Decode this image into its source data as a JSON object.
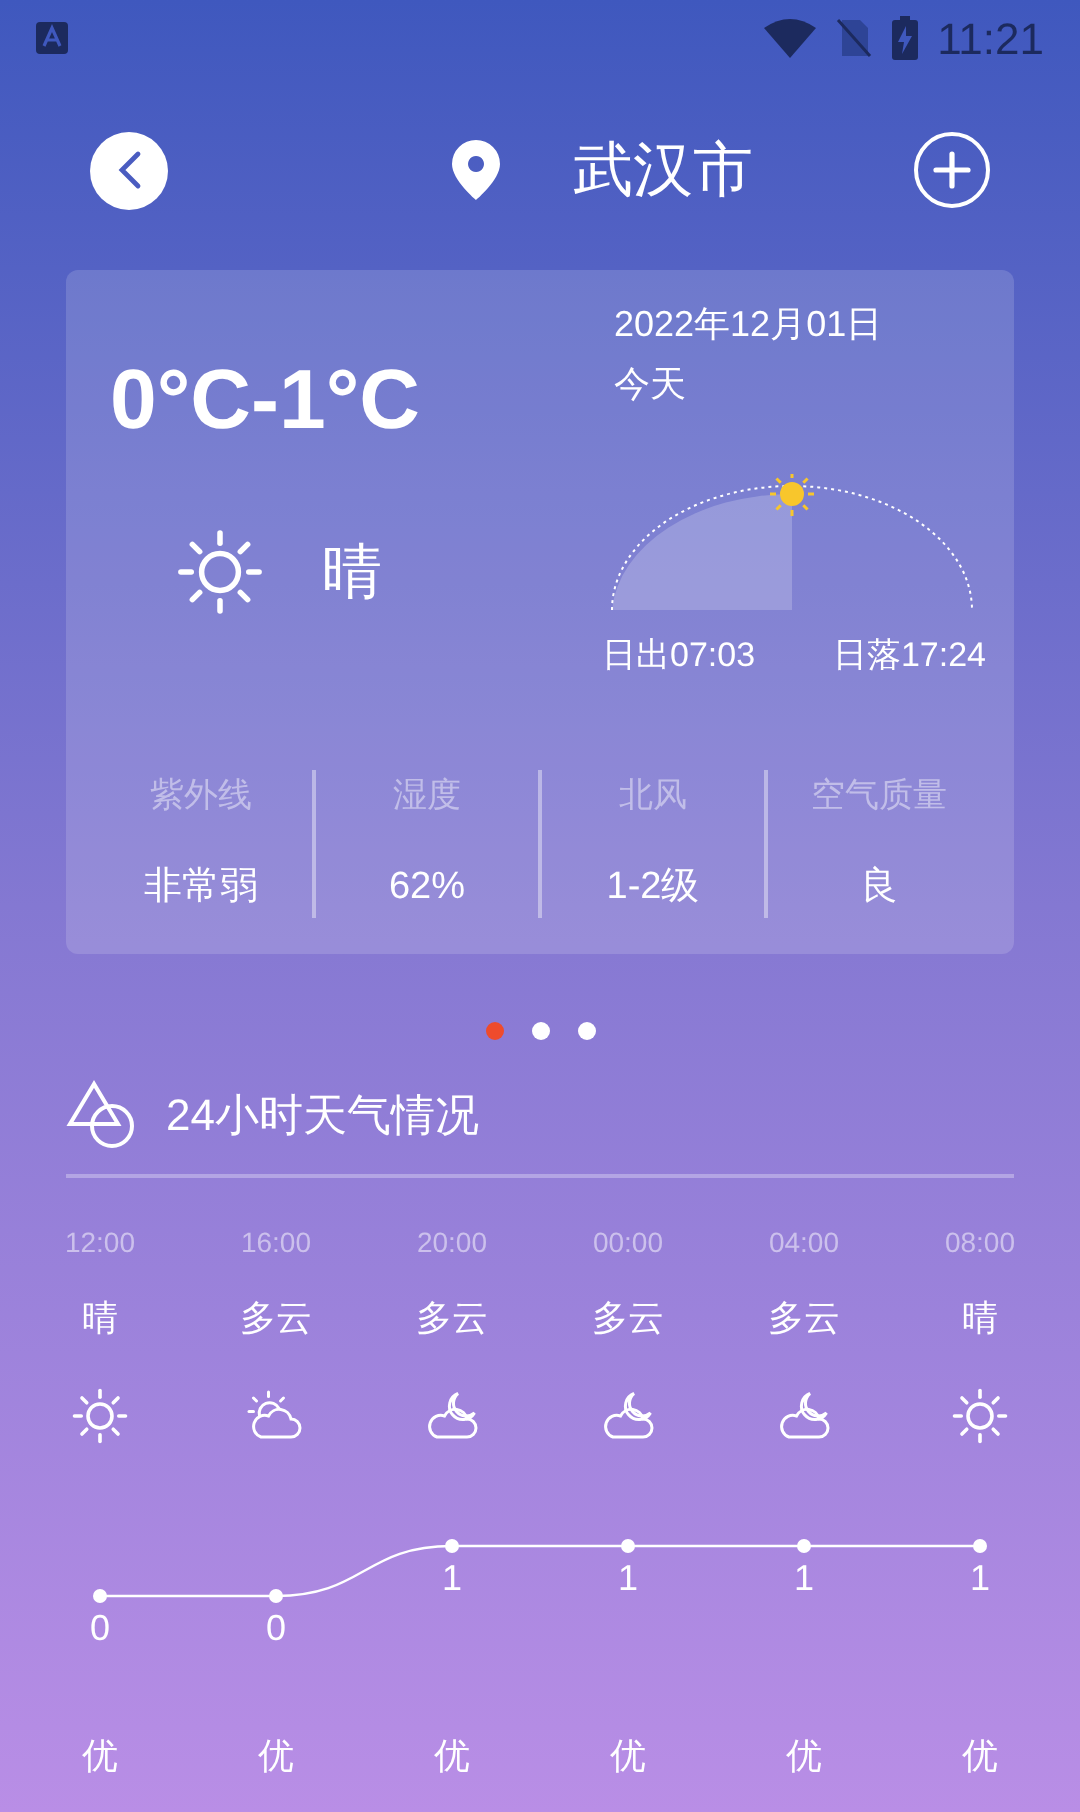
{
  "status_bar": {
    "time": "11:21"
  },
  "header": {
    "city": "武汉市"
  },
  "today": {
    "temperature": "0°C-1°C",
    "date": "2022年12月01日",
    "day": "今天",
    "condition": "晴",
    "sunrise": "日出07:03",
    "sunset": "日落17:24",
    "details": [
      {
        "label": "紫外线",
        "value": "非常弱"
      },
      {
        "label": "湿度",
        "value": "62%"
      },
      {
        "label": "北风",
        "value": "1-2级"
      },
      {
        "label": "空气质量",
        "value": "良"
      }
    ]
  },
  "pager": [
    {
      "selected": true
    },
    {
      "selected": false
    },
    {
      "selected": false
    }
  ],
  "hourly": {
    "title": "24小时天气情况",
    "items": [
      {
        "time": "12:00",
        "condition": "晴",
        "kind": "sun",
        "value": "0",
        "air": "优"
      },
      {
        "time": "16:00",
        "condition": "多云",
        "kind": "cloud-sun",
        "value": "0",
        "air": "优"
      },
      {
        "time": "20:00",
        "condition": "多云",
        "kind": "cloud-moon",
        "value": "1",
        "air": "优"
      },
      {
        "time": "00:00",
        "condition": "多云",
        "kind": "cloud-moon",
        "value": "1",
        "air": "优"
      },
      {
        "time": "04:00",
        "condition": "多云",
        "kind": "cloud-moon",
        "value": "1",
        "air": "优"
      },
      {
        "time": "08:00",
        "condition": "晴",
        "kind": "sun",
        "value": "1",
        "air": "优"
      }
    ]
  }
}
